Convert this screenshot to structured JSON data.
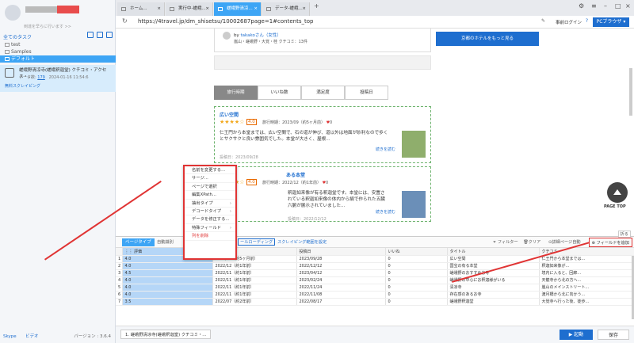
{
  "left": {
    "profile_sub": "到達を早らに行います >>",
    "all_tasks": "全てのタスク",
    "tree": [
      "test",
      "Samples",
      "デフォルト"
    ],
    "task": {
      "title": "嵯峨野清凉寺(嵯峨釈迦堂) クチコミ・アクセス・...",
      "count_label": "データ数:",
      "count": "179",
      "date": "2024-01-16 11:54:6",
      "action": "無料スクレイピング"
    },
    "skype": "Skype",
    "youtube": "ビデオ",
    "version": "バージョン : 3.6.4"
  },
  "tabs": [
    "ホーム...",
    "実行中-嵯峨...",
    "嵯峨野清凉...",
    "データ-嵯峨..."
  ],
  "address": {
    "url": "https://4travel.jp/dm_shisetsu/10002687page=1#contents_top",
    "login": "事前ログイン",
    "pc": "PCブラウザ"
  },
  "page": {
    "author_prefix": "by",
    "author": "takakoさん（女性）",
    "author_sub": "嵐山・嵯峨野・大覚・桂 クチコミ：13件",
    "hotel_btn": "京都のホテルをもっと見る",
    "sort_tabs": [
      "旅行時期",
      "いいね数",
      "満足度",
      "投稿日"
    ],
    "reviews": [
      {
        "title": "広い空間",
        "score": "4.0",
        "meta": "旅行時期：2023/09（約5ヶ月前）",
        "likes": "0",
        "body": "仁王門から本堂までは、広い空間で、石の道が伸び、道以外は地面が砂利なので歩くとサクサクと良い雰囲気でした。本堂が大きく、屋根...",
        "more": "続きを読む",
        "date": "投稿日：2023/09/28"
      },
      {
        "title": "ある本堂",
        "score": "4.0",
        "meta": "旅行時期：2022/12（約1年前）",
        "likes": "0",
        "body": "釈迦如来像が有る釈迦堂です。本堂には、安置されている釈迦如来像の体内から絹で作られた五臓六腑が展示されていました...",
        "more": "続きを読む",
        "date": "投稿日：2022/12/12"
      }
    ],
    "pagetop": "PAGE TOP"
  },
  "context_menu": [
    "名前を変更する...",
    "サージ...",
    "ページで選択",
    "編集XPath...",
    "抽出タイプ",
    "デコードタイプ",
    "データを修正する...",
    "特殊フィールド",
    "列を削除"
  ],
  "data_toolbar": {
    "page_type": "ページタイプ",
    "auto_detect": "自動識別",
    "scroll": "ールローディング",
    "scrape_range": "スクレイピング範囲を設定",
    "filter": "フィルター",
    "clear": "クリア",
    "detail_page": "詳細ページ自動",
    "add_field": "フィールドを追加",
    "fold": "折る"
  },
  "table": {
    "headers": [
      "",
      "評価",
      "旅行時期",
      "投稿日",
      "いいね",
      "タイトル",
      "クチコミ"
    ],
    "rows": [
      [
        "1",
        "4.0",
        "2023/09（約5ヶ月前）",
        "2023/09/28",
        "0",
        "広い空間",
        "仁王門から本堂までは..."
      ],
      [
        "2",
        "4.0",
        "2022/12（約1年前）",
        "2022/12/12",
        "0",
        "国宝の有る本堂",
        "釈迦如来像が..."
      ],
      [
        "3",
        "4.5",
        "2022/11（約1年前）",
        "2023/04/12",
        "0",
        "嵯峨野のおすすめお寺",
        "境内に入ると、回廊..."
      ],
      [
        "4",
        "4.0",
        "2022/11（約1年前）",
        "2023/02/24",
        "0",
        "嵯峨野の中心にお釈迦様がいる",
        "天龍寺から北の方へ..."
      ],
      [
        "5",
        "4.0",
        "2022/11（約1年前）",
        "2022/11/24",
        "0",
        "清凉寺",
        "嵐山のメインストリート..."
      ],
      [
        "6",
        "4.0",
        "2022/11（約1年前）",
        "2022/11/08",
        "0",
        "存在感のあるお寺",
        "渡月橋から北に向かう..."
      ],
      [
        "7",
        "3.5",
        "2022/07（約2年前）",
        "2022/08/17",
        "0",
        "嵯峨野釈迦堂",
        "大覚寺へ行った後、徒歩..."
      ]
    ]
  },
  "footer": {
    "task_tab": "1. 嵯峨野清凉寺(嵯峨釈迦堂) クチコミ・...",
    "run": "起動",
    "save": "保存"
  }
}
